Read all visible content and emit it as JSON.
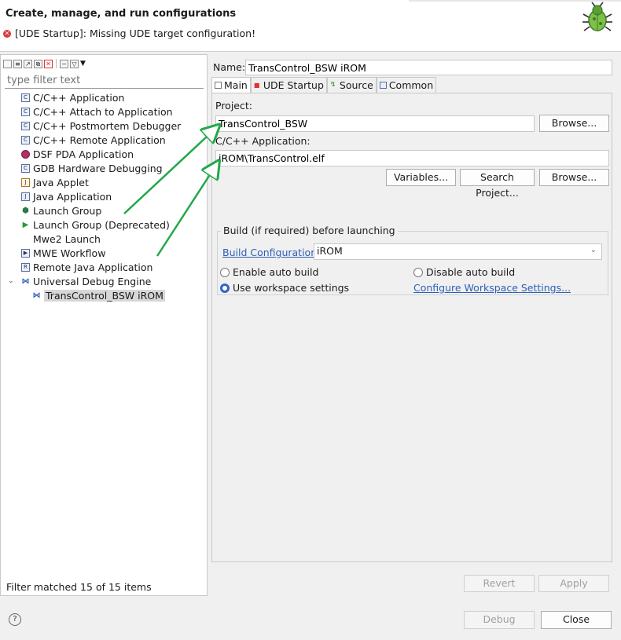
{
  "header": {
    "title": "Create, manage, and run configurations",
    "error_message": "[UDE Startup]: Missing UDE target configuration!"
  },
  "left": {
    "filter_placeholder": "type filter text",
    "tree": [
      {
        "label": "C/C++ Application",
        "icon": "c-app-icon"
      },
      {
        "label": "C/C++ Attach to Application",
        "icon": "c-app-icon"
      },
      {
        "label": "C/C++ Postmortem Debugger",
        "icon": "c-app-icon"
      },
      {
        "label": "C/C++ Remote Application",
        "icon": "c-app-icon"
      },
      {
        "label": "DSF PDA Application",
        "icon": "dsf-icon"
      },
      {
        "label": "GDB Hardware Debugging",
        "icon": "c-app-icon"
      },
      {
        "label": "Java Applet",
        "icon": "java-applet-icon"
      },
      {
        "label": "Java Application",
        "icon": "java-app-icon"
      },
      {
        "label": "Launch Group",
        "icon": "launch-group-icon"
      },
      {
        "label": "Launch Group (Deprecated)",
        "icon": "play-icon"
      },
      {
        "label": "Mwe2 Launch",
        "icon": ""
      },
      {
        "label": "MWE Workflow",
        "icon": "mwe-icon"
      },
      {
        "label": "Remote Java Application",
        "icon": "remote-java-icon"
      },
      {
        "label": "Universal Debug Engine",
        "icon": "ude-icon"
      },
      {
        "label": "TransControl_BSW iROM",
        "icon": "ude-icon"
      }
    ],
    "status": "Filter matched 15 of 15 items"
  },
  "right": {
    "name_label": "Name:",
    "name_value": "TransControl_BSW iROM",
    "tabs": [
      "Main",
      "UDE Startup",
      "Source",
      "Common"
    ],
    "project_label": "Project:",
    "project_value": "TransControl_BSW",
    "browse_label": "Browse...",
    "app_label": "C/C++ Application:",
    "app_value": "iROM\\TransControl.elf",
    "variables_label": "Variables...",
    "search_project_label": "Search Project...",
    "build_group_title": "Build (if required) before launching",
    "build_config_link": "Build Configuration:",
    "build_config_value": "iROM",
    "enable_auto_build": "Enable auto build",
    "disable_auto_build": "Disable auto build",
    "use_workspace_settings": "Use workspace settings",
    "configure_workspace_link": "Configure Workspace Settings...",
    "revert_label": "Revert",
    "apply_label": "Apply"
  },
  "footer": {
    "help_glyph": "?",
    "debug_label": "Debug",
    "close_label": "Close"
  },
  "colors": {
    "accent": "#2f64c9",
    "link": "#2d5fb8",
    "error": "#d83a3a",
    "annotation_arrow": "#22a84a"
  }
}
